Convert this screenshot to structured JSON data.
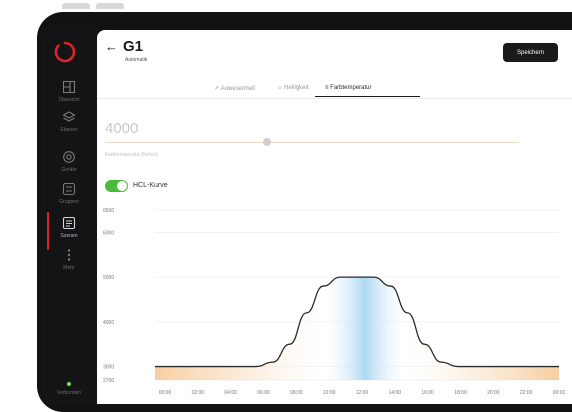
{
  "sidebar": {
    "items": [
      {
        "label": "Übersicht",
        "icon": "floorplan-icon"
      },
      {
        "label": "Ebenen",
        "icon": "layers-icon"
      },
      {
        "label": "Geräte",
        "icon": "devices-icon"
      },
      {
        "label": "Gruppen",
        "icon": "groups-icon"
      },
      {
        "label": "Szenen",
        "icon": "scenes-icon"
      },
      {
        "label": "Mehr",
        "icon": "more-icon"
      }
    ],
    "status_label": "Verbunden"
  },
  "header": {
    "title": "G1",
    "subtitle": "Automatik",
    "save_label": "Speichern"
  },
  "tabs": [
    {
      "label": "Anwesenheit",
      "icon": "presence-icon"
    },
    {
      "label": "Helligkeit",
      "icon": "brightness-icon"
    },
    {
      "label": "Farbtemperatur",
      "icon": "color-temp-icon"
    }
  ],
  "active_tab": "Farbtemperatur",
  "temperature": {
    "value": "4000",
    "caption": "Farbtemperatur (Kelvin)",
    "slider_fraction": 0.38
  },
  "hcl": {
    "label": "HCL-Kurve",
    "enabled": true
  },
  "colors": {
    "accent": "#d8252a",
    "toggle_on": "#4cbb3c",
    "warm": "#f6c996",
    "cool": "#a9d6f2"
  },
  "chart_data": {
    "type": "area",
    "x_ticks": [
      "00:00",
      "02:00",
      "04:00",
      "06:00",
      "08:00",
      "10:00",
      "12:00",
      "14:00",
      "16:00",
      "18:00",
      "20:00",
      "22:00",
      "00:00"
    ],
    "y_ticks": [
      6500,
      6000,
      5000,
      4000,
      3000,
      2700
    ],
    "y_tick_labels": [
      "6500",
      "6000",
      "5000",
      "4000",
      "3000",
      "2700"
    ],
    "ylim": [
      2700,
      6500
    ],
    "x": [
      0,
      6,
      7,
      8,
      9,
      10,
      11,
      13,
      14,
      15,
      16,
      17,
      18,
      24
    ],
    "y": [
      3000,
      3000,
      3100,
      3500,
      4200,
      4800,
      5000,
      5000,
      4800,
      4200,
      3500,
      3100,
      3000,
      3000
    ],
    "grid": true
  }
}
